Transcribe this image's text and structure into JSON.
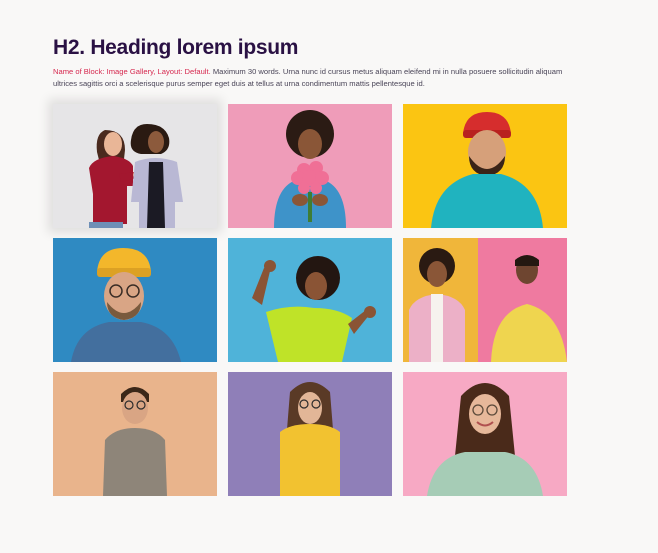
{
  "heading": "H2. Heading lorem ipsum",
  "description": {
    "block_name": "Name of Block: Image Gallery, Layout: Default.",
    "body": " Maximum 30 words. Urna nunc id cursus metus aliquam eleifend mi in nulla posuere sollicitudin aliquam ultrices sagittis orci a scelerisque purus semper eget duis at tellus at urna condimentum mattis pellentesque id."
  },
  "gallery": {
    "images": [
      {
        "subject": "two-women-bumping-fists",
        "background": "#e6e5e7"
      },
      {
        "subject": "woman-holding-pink-flowers",
        "background": "#ef9cb9"
      },
      {
        "subject": "man-in-red-beanie-smiling",
        "background": "#fbc512"
      },
      {
        "subject": "man-in-yellow-beanie-glasses",
        "background": "#2f8ac2"
      },
      {
        "subject": "woman-dancing-green-shirt",
        "background": "#4fb3d9"
      },
      {
        "subject": "woman-and-man-smiling",
        "background": "#f0b63a"
      },
      {
        "subject": "man-with-glasses-beige",
        "background": "#e9b48c"
      },
      {
        "subject": "woman-in-yellow-sweater",
        "background": "#8f7fb8"
      },
      {
        "subject": "woman-with-glasses-smiling",
        "background": "#f7a9c4"
      }
    ]
  }
}
